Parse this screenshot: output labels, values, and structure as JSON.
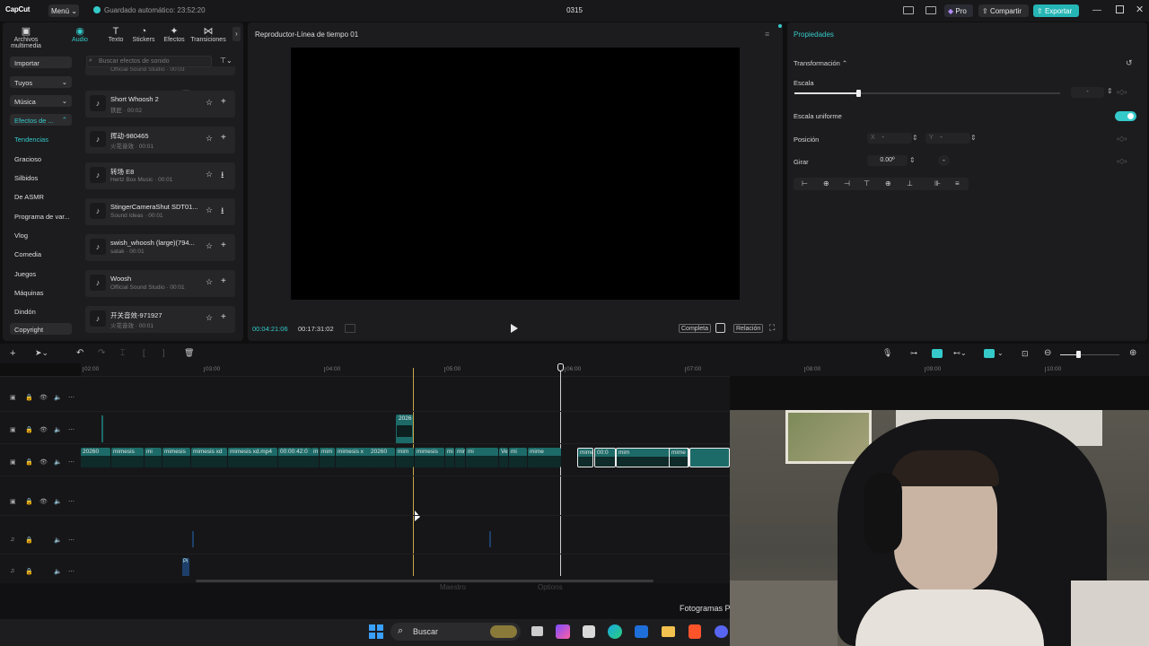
{
  "app": {
    "logo": "CapCut",
    "menu_label": "Menú",
    "autosave_text": "Guardado automático: 23:52:20",
    "project_title": "0315",
    "pro_label": "Pro",
    "share_label": "Compartir",
    "export_label": "Exportar"
  },
  "media_tabs": [
    {
      "label": "Archivos multimedia",
      "icon": "media-icon"
    },
    {
      "label": "Audio",
      "icon": "audio-icon",
      "active": true
    },
    {
      "label": "Texto",
      "icon": "text-icon"
    },
    {
      "label": "Stickers",
      "icon": "sticker-icon"
    },
    {
      "label": "Efectos",
      "icon": "effects-icon"
    },
    {
      "label": "Transiciones",
      "icon": "transitions-icon"
    }
  ],
  "categories": [
    {
      "label": "Importar",
      "style": "btn"
    },
    {
      "label": "Tuyos",
      "style": "btn",
      "chevron": "⌄"
    },
    {
      "label": "Música",
      "style": "btn",
      "chevron": "⌄"
    },
    {
      "label": "Efectos de ...",
      "style": "sel",
      "chevron": "⌃"
    },
    {
      "label": "Tendencias",
      "style": "txtsel"
    },
    {
      "label": "Gracioso"
    },
    {
      "label": "Silbidos"
    },
    {
      "label": "De ASMR"
    },
    {
      "label": "Programa de var..."
    },
    {
      "label": "Vlog"
    },
    {
      "label": "Comedia"
    },
    {
      "label": "Juegos"
    },
    {
      "label": "Máquinas"
    },
    {
      "label": "Dindón"
    },
    {
      "label": "Copyright",
      "style": "btn"
    }
  ],
  "search": {
    "placeholder": "Buscar efectos de sonido"
  },
  "partial_card_subtitle": "Official Sound Studio · 00:03",
  "sound_effects": [
    {
      "title": "Short Whoosh 2",
      "subtitle": "铁匠 · 00:02",
      "action": "+"
    },
    {
      "title": "挥动-980465",
      "subtitle": "火花音效 · 00:01",
      "action": "+"
    },
    {
      "title": "转场 E8",
      "subtitle": "Hertz Box Music · 00:01",
      "action": "⭳"
    },
    {
      "title": "StingerCameraShut SDT01...",
      "subtitle": "Sound Ideas · 00:01",
      "action": "⭳"
    },
    {
      "title": "swish_whoosh (large)(794...",
      "subtitle": "satak · 00:01",
      "action": "+"
    },
    {
      "title": "Woosh",
      "subtitle": "Official Sound Studio · 00:01",
      "action": "+"
    },
    {
      "title": "开关音效-971927",
      "subtitle": "火花音效 · 00:01",
      "action": "+"
    }
  ],
  "player": {
    "title": "Reproductor-Línea de tiempo 01",
    "current_time": "00:04:21:06",
    "total_time": "00:17:31:02",
    "full_label": "Completa",
    "ratio_label": "Relación"
  },
  "properties": {
    "title": "Propiedades",
    "section": "Transformación",
    "scale_label": "Escala",
    "scale_value": "-",
    "scale_fraction": 0.12,
    "uniform_label": "Escala uniforme",
    "uniform_on": true,
    "position_label": "Posición",
    "x_label": "X",
    "x_value": "-",
    "y_label": "Y",
    "y_value": "-",
    "rotate_label": "Girar",
    "rotate_value": "0.00º",
    "rotate_reset": "-"
  },
  "timeline": {
    "ruler_ticks": [
      "02:00",
      "03:00",
      "04:00",
      "05:00",
      "06:00",
      "07:00",
      "08:00",
      "09:00",
      "10:00"
    ],
    "overlay_clip_label": "2026",
    "clip_labels": [
      "20260",
      "mimesis",
      "mi",
      "mimesis",
      "mimesis xd",
      "mimesis xd.mp4",
      "00:00:42:0",
      "m",
      "mim",
      "mimesis x",
      "20260",
      "mim",
      "mimesis",
      "mi",
      "mimesis",
      "mi",
      "Velocida",
      "mi",
      "mime",
      "mimesis xd.mp4",
      "00:0",
      "mim",
      "mime"
    ],
    "audio_clip_label": "Pi"
  },
  "bottom": {
    "partial_left": "Fotogramas P",
    "partial_mid1": "Maestro",
    "partial_mid2": "Options"
  },
  "taskbar": {
    "search_label": "Buscar"
  },
  "colors": {
    "accent": "#35c9c9",
    "clip": "#1d6b68",
    "playhead": "#c8a74a"
  }
}
